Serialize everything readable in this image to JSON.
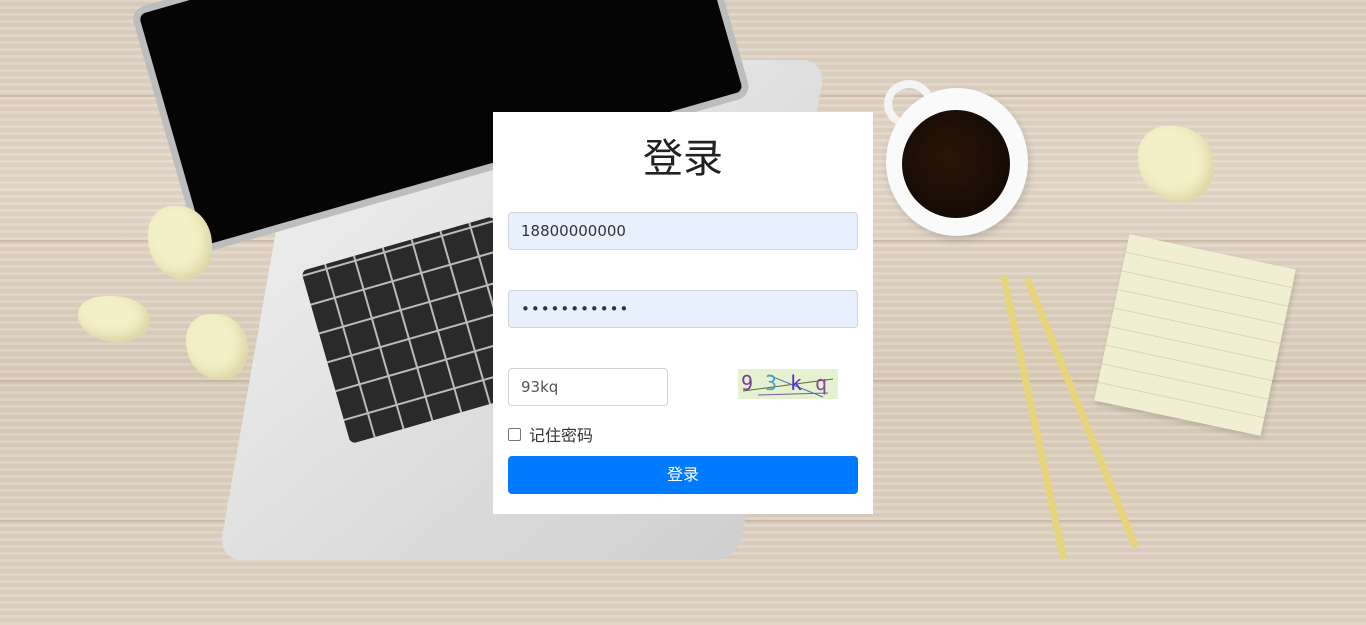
{
  "login": {
    "title": "登录",
    "username_value": "18800000000",
    "password_masked": "•••••••••••",
    "captcha_input_value": "93kq",
    "captcha_image_text": "93kq",
    "remember_label": "记住密码",
    "remember_checked": false,
    "submit_label": "登录"
  },
  "colors": {
    "primary": "#007bff",
    "autofill_bg": "#e8f0fe",
    "panel_bg": "#ffffff"
  }
}
